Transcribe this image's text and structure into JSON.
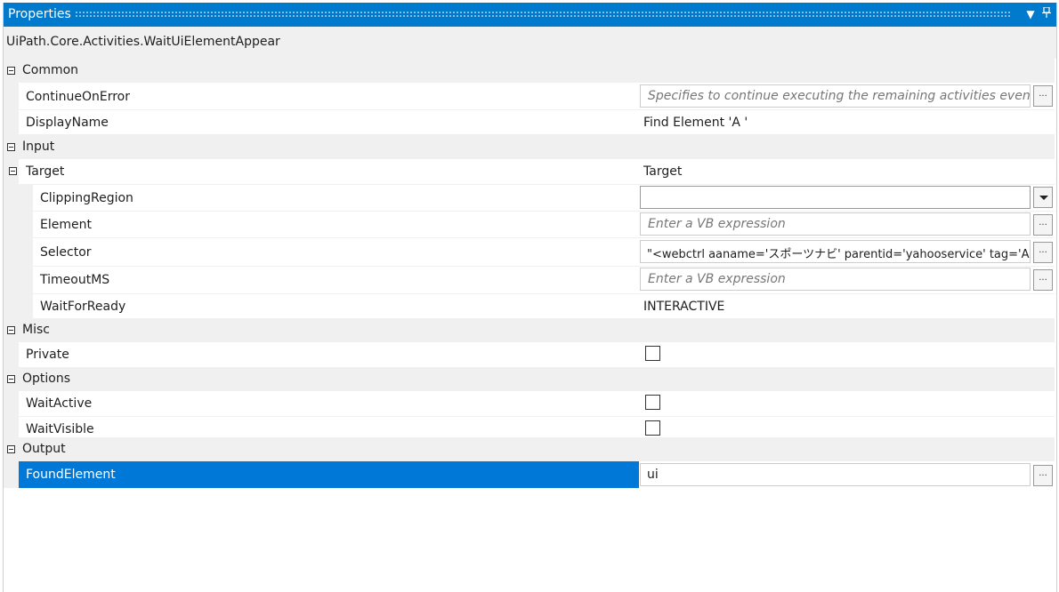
{
  "panel": {
    "title": "Properties",
    "activity_type": "UiPath.Core.Activities.WaitUiElementAppear"
  },
  "icons": {
    "dropdown": "chevron-down-icon",
    "pin": "pin-icon",
    "expander": "collapse-minus-icon",
    "ellipsis": "..."
  },
  "categories": {
    "common": "Common",
    "input": "Input",
    "misc": "Misc",
    "options": "Options",
    "output": "Output"
  },
  "properties": {
    "continue_on_error": {
      "name": "ContinueOnError",
      "placeholder": "Specifies to continue executing the remaining activities even if the current activity fails."
    },
    "display_name": {
      "name": "DisplayName",
      "value": "Find Element 'A '"
    },
    "target": {
      "name": "Target",
      "value": "Target"
    },
    "clipping_region": {
      "name": "ClippingRegion",
      "value": ""
    },
    "element": {
      "name": "Element",
      "placeholder": "Enter a VB expression"
    },
    "selector": {
      "name": "Selector",
      "value": "\"<webctrl aaname='スポーツナビ' parentid='yahooservice' tag='A' />\""
    },
    "timeout_ms": {
      "name": "TimeoutMS",
      "placeholder": "Enter a VB expression"
    },
    "wait_for_ready": {
      "name": "WaitForReady",
      "value": "INTERACTIVE"
    },
    "private": {
      "name": "Private",
      "checked": false
    },
    "wait_active": {
      "name": "WaitActive",
      "checked": false
    },
    "wait_visible": {
      "name": "WaitVisible",
      "checked": false
    },
    "found_element": {
      "name": "FoundElement",
      "value": "ui"
    }
  },
  "colors": {
    "accent": "#007acc",
    "selection": "#0078d7",
    "category_bg": "#f0f0f0"
  }
}
